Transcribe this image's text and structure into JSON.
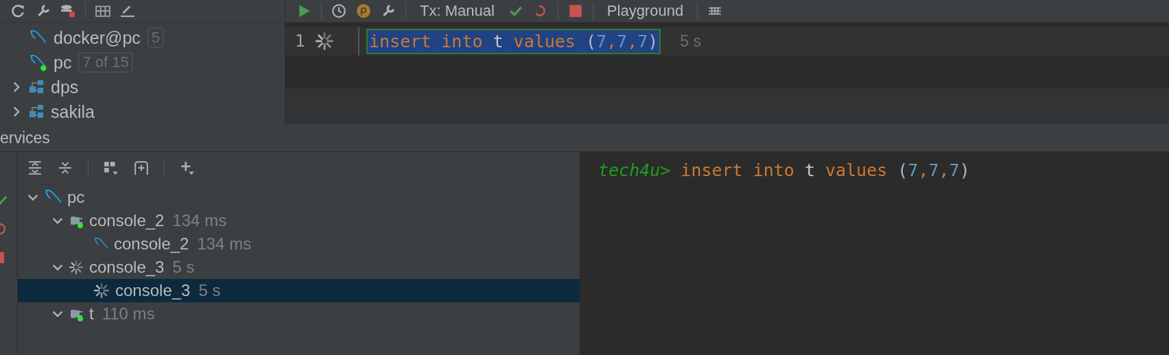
{
  "db_explorer": {
    "items": [
      {
        "label": "docker@pc",
        "badge": "5",
        "kind": "datasource",
        "connected": false
      },
      {
        "label": "pc",
        "badge": "7 of 15",
        "kind": "datasource",
        "connected": true
      },
      {
        "label": "dps",
        "kind": "schema",
        "expanded": false
      },
      {
        "label": "sakila",
        "kind": "schema",
        "expanded": false
      }
    ]
  },
  "editor_toolbar": {
    "tx_mode": "Tx: Manual",
    "session": "Playground"
  },
  "editor": {
    "lines": [
      {
        "number": "1",
        "running": true,
        "selected": true,
        "duration": "5 s",
        "words": [
          [
            {
              "text": "insert",
              "kind": "keyword"
            }
          ],
          [
            {
              "text": "into",
              "kind": "keyword"
            }
          ],
          [
            {
              "text": "t",
              "kind": "ident"
            }
          ],
          [
            {
              "text": "values",
              "kind": "keyword"
            }
          ],
          [
            {
              "text": "(",
              "kind": "paren"
            },
            {
              "text": "7",
              "kind": "number"
            },
            {
              "text": ",",
              "kind": "keyword"
            },
            {
              "text": "7",
              "kind": "number"
            },
            {
              "text": ",",
              "kind": "keyword"
            },
            {
              "text": "7",
              "kind": "number"
            },
            {
              "text": ")",
              "kind": "paren"
            }
          ]
        ]
      }
    ]
  },
  "services": {
    "title": "ervices",
    "items": [
      {
        "label": "pc",
        "kind": "datasource",
        "expanded": true,
        "selected": false,
        "children": [
          {
            "label": "console_2",
            "time": "134 ms",
            "kind": "session",
            "connected": true,
            "running": false,
            "expanded": true,
            "selected": false,
            "children": [
              {
                "label": "console_2",
                "time": "134 ms",
                "kind": "console",
                "running": false,
                "selected": false
              }
            ]
          },
          {
            "label": "console_3",
            "time": "5 s",
            "kind": "session",
            "running": true,
            "expanded": true,
            "selected": false,
            "children": [
              {
                "label": "console_3",
                "time": "5 s",
                "kind": "console",
                "running": true,
                "selected": true
              }
            ]
          },
          {
            "label": "t",
            "time": "110 ms",
            "kind": "session",
            "connected": true,
            "running": false,
            "expanded": true,
            "selected": false
          }
        ]
      }
    ]
  },
  "console": {
    "prompt": "tech4u>",
    "words": [
      [
        {
          "text": "insert",
          "kind": "keyword"
        }
      ],
      [
        {
          "text": "into",
          "kind": "keyword"
        }
      ],
      [
        {
          "text": "t",
          "kind": "ident"
        }
      ],
      [
        {
          "text": "values",
          "kind": "keyword"
        }
      ],
      [
        {
          "text": "(",
          "kind": "paren"
        },
        {
          "text": "7",
          "kind": "number"
        },
        {
          "text": ",",
          "kind": "keyword"
        },
        {
          "text": "7",
          "kind": "number"
        },
        {
          "text": ",",
          "kind": "keyword"
        },
        {
          "text": "7",
          "kind": "number"
        },
        {
          "text": ")",
          "kind": "paren"
        }
      ]
    ]
  }
}
